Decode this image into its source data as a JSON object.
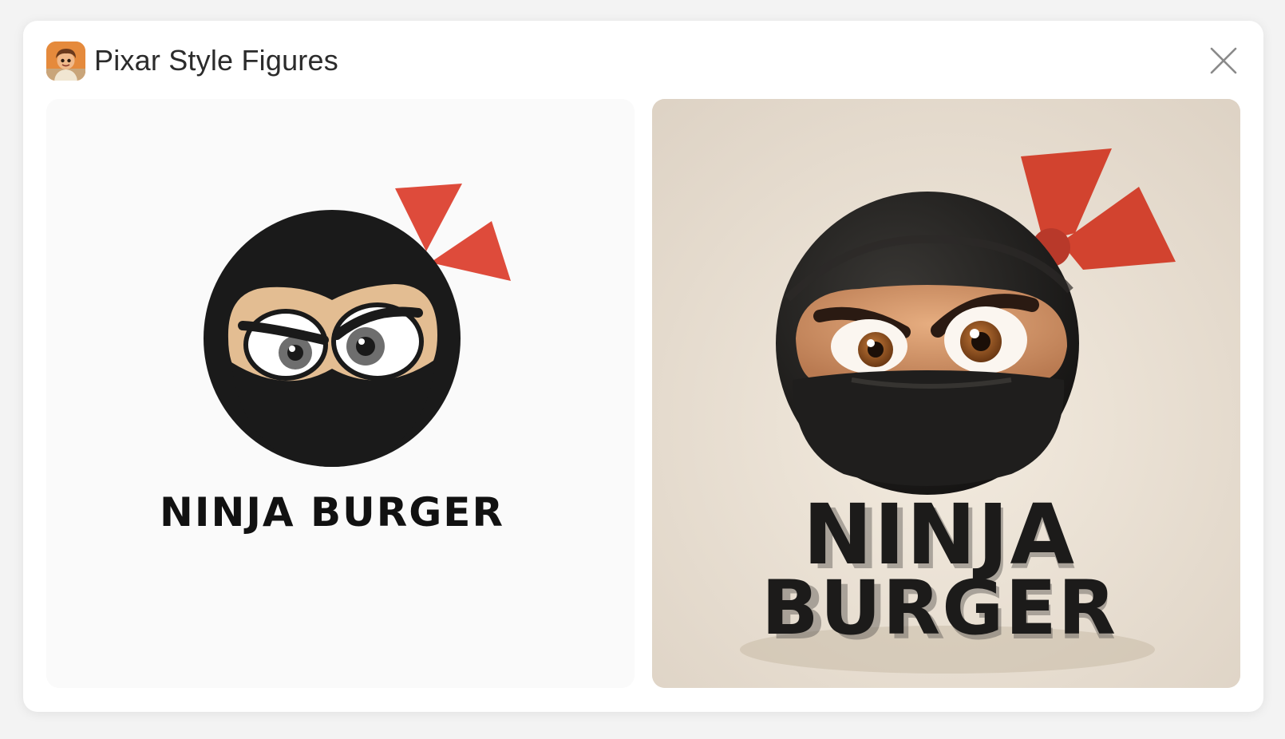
{
  "dialog": {
    "title": "Pixar Style Figures",
    "app_icon": "pixar-avatar-icon",
    "close_icon": "close-icon"
  },
  "images": [
    {
      "name": "original-logo",
      "logo_text": "NINJA BURGER",
      "colors": {
        "mask": "#1a1a1a",
        "skin": "#e3bd92",
        "ribbon": "#de4b3b",
        "background": "#fafafa"
      }
    },
    {
      "name": "pixar-style-logo",
      "logo_text_line1": "NINJA",
      "logo_text_line2": "BURGER",
      "colors": {
        "mask": "#1f1e1d",
        "skin": "#d79a6c",
        "ribbon": "#d2432f",
        "background": "#e7ddd0"
      }
    }
  ]
}
